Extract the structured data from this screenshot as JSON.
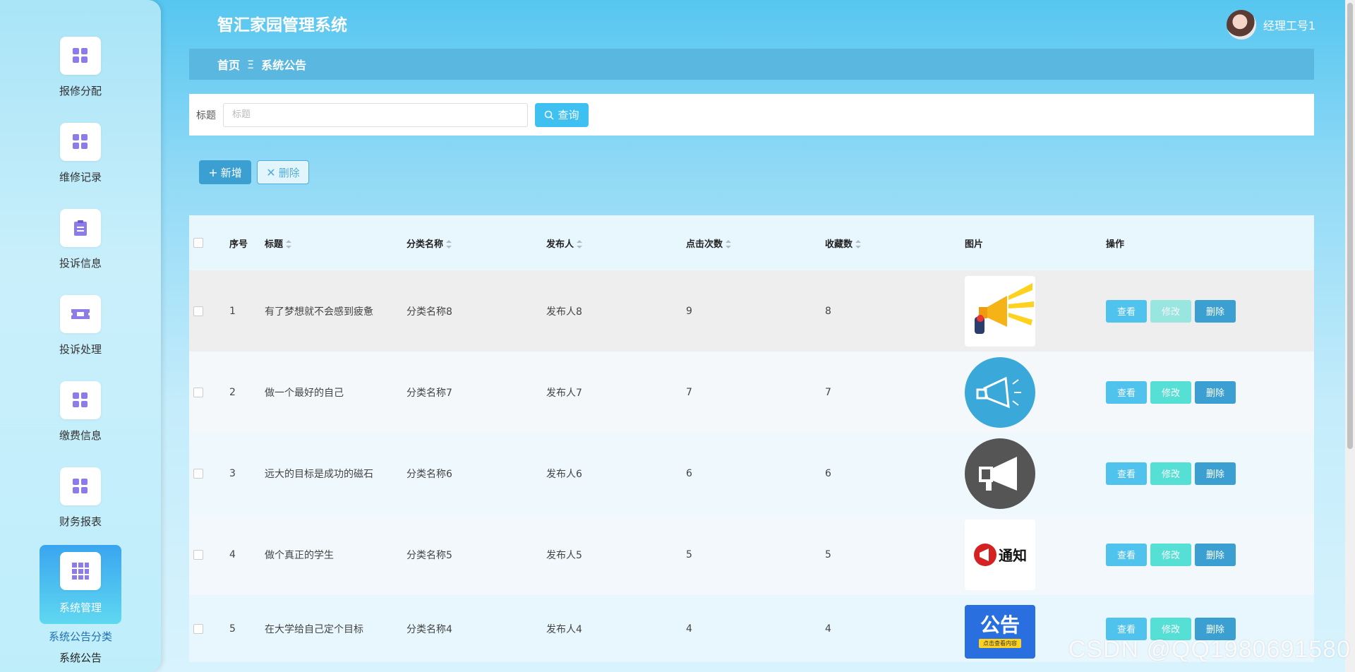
{
  "app": {
    "title": "智汇家园管理系统"
  },
  "user": {
    "name": "经理工号1"
  },
  "sidebar": {
    "items": [
      {
        "label": "报修分配",
        "icon": "grid-icon"
      },
      {
        "label": "维修记录",
        "icon": "grid-icon"
      },
      {
        "label": "投诉信息",
        "icon": "clipboard-icon"
      },
      {
        "label": "投诉处理",
        "icon": "ticket-icon"
      },
      {
        "label": "缴费信息",
        "icon": "grid-icon"
      },
      {
        "label": "财务报表",
        "icon": "grid-icon"
      },
      {
        "label": "系统管理",
        "icon": "grid9-icon"
      }
    ],
    "submenu": [
      {
        "label": "系统公告分类"
      },
      {
        "label": "系统公告"
      }
    ]
  },
  "breadcrumb": {
    "home": "首页",
    "separator": "Ξ",
    "current": "系统公告"
  },
  "search": {
    "label": "标题",
    "placeholder": "标题",
    "value": "",
    "button_label": "查询"
  },
  "toolbar": {
    "add_label": "新增",
    "delete_label": "删除"
  },
  "table": {
    "headers": {
      "index": "序号",
      "title": "标题",
      "category": "分类名称",
      "publisher": "发布人",
      "clicks": "点击次数",
      "favorites": "收藏数",
      "image": "图片",
      "operations": "操作"
    },
    "ops": {
      "view": "查看",
      "edit": "修改",
      "delete": "删除"
    },
    "rows": [
      {
        "index": "1",
        "title": "有了梦想就不会感到疲惫",
        "category": "分类名称8",
        "publisher": "发布人8",
        "clicks": "9",
        "favorites": "8",
        "image": "megaphone-yellow"
      },
      {
        "index": "2",
        "title": "做一个最好的自己",
        "category": "分类名称7",
        "publisher": "发布人7",
        "clicks": "7",
        "favorites": "7",
        "image": "megaphone-blue-circle"
      },
      {
        "index": "3",
        "title": "远大的目标是成功的磁石",
        "category": "分类名称6",
        "publisher": "发布人6",
        "clicks": "6",
        "favorites": "6",
        "image": "megaphone-dark-circle"
      },
      {
        "index": "4",
        "title": "做个真正的学生",
        "category": "分类名称5",
        "publisher": "发布人5",
        "clicks": "5",
        "favorites": "5",
        "image": "notice-logo"
      },
      {
        "index": "5",
        "title": "在大学给自己定个目标",
        "category": "分类名称4",
        "publisher": "发布人4",
        "clicks": "4",
        "favorites": "4",
        "image": "announcement-banner"
      }
    ]
  },
  "thumb_text": {
    "notice": "通知",
    "announce": "公告",
    "announce_sub": "点击查看内容"
  },
  "watermark": "CSDN @QQ1980691580"
}
